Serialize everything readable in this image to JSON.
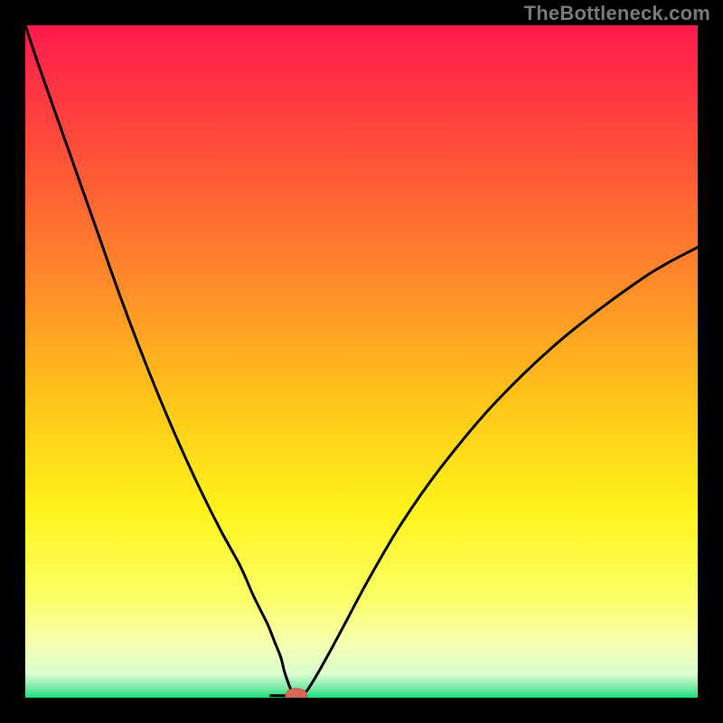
{
  "watermark": "TheBottleneck.com",
  "colors": {
    "frame": "#000000",
    "gradient_stops": [
      {
        "offset": 0.0,
        "color": "#ff1a4c"
      },
      {
        "offset": 0.18,
        "color": "#ff4d3a"
      },
      {
        "offset": 0.38,
        "color": "#ff8a2a"
      },
      {
        "offset": 0.55,
        "color": "#ffc21a"
      },
      {
        "offset": 0.72,
        "color": "#fff31a"
      },
      {
        "offset": 0.85,
        "color": "#fbff66"
      },
      {
        "offset": 0.92,
        "color": "#f6ffb0"
      },
      {
        "offset": 0.965,
        "color": "#d9ffd0"
      },
      {
        "offset": 0.985,
        "color": "#7de8a8"
      },
      {
        "offset": 1.0,
        "color": "#19e07a"
      }
    ],
    "curve": "#000000",
    "marker_fill": "#d66a5a",
    "marker_stroke": "#c85a4a"
  },
  "chart_data": {
    "type": "line",
    "title": "",
    "xlabel": "",
    "ylabel": "",
    "xlim": [
      0,
      100
    ],
    "ylim": [
      0,
      100
    ],
    "series": [
      {
        "name": "bottleneck-curve",
        "x": [
          0,
          2,
          5,
          8,
          11,
          14,
          17,
          20,
          23,
          26,
          29,
          32,
          34,
          36,
          37,
          38,
          38.5,
          39,
          39.5,
          40,
          41,
          42,
          44,
          47,
          51,
          56,
          62,
          70,
          80,
          92,
          100
        ],
        "y": [
          100,
          94,
          85.5,
          77,
          68.5,
          60,
          52,
          44.5,
          37.5,
          31,
          25,
          19.5,
          15,
          11,
          8.5,
          6,
          4,
          2.5,
          1.2,
          0.4,
          0.2,
          1.2,
          4.5,
          10,
          17.5,
          26,
          34.5,
          44,
          53.5,
          62.5,
          67
        ]
      }
    ],
    "flat_segment": {
      "x_start": 36.5,
      "x_end": 40.5,
      "y": 0.3
    },
    "marker": {
      "x": 40.3,
      "y": 0.35,
      "rx": 1.6,
      "ry": 1.05
    }
  }
}
